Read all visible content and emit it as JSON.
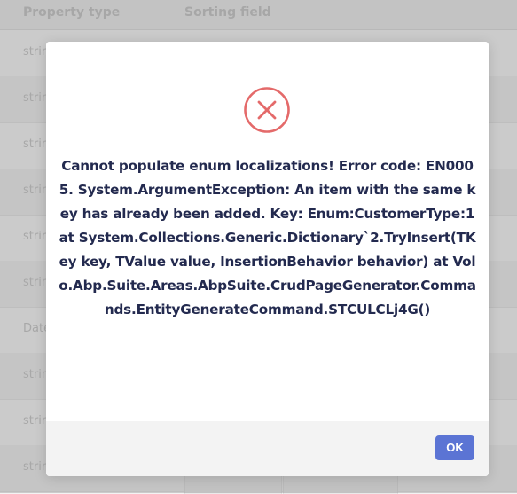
{
  "table": {
    "headers": [
      "Property type",
      "Sorting field"
    ],
    "rows": [
      "string",
      "string",
      "string",
      "string",
      "string",
      "string",
      "DateTime",
      "string",
      "string",
      "string"
    ]
  },
  "dialog": {
    "icon": "error-x-circle-icon",
    "message": "Cannot populate enum localizations! Error code: EN0005. System.ArgumentException: An item with the same key has already been added. Key: Enum:CustomerType:1 at System.Collections.Generic.Dictionary`2.TryInsert(TKey key, TValue value, InsertionBehavior behavior) at Volo.Abp.Suite.Areas.AbpSuite.CrudPageGenerator.Commands.EntityGenerateCommand.STCULCLj4G()",
    "ok_label": "OK"
  },
  "colors": {
    "accent": "#5b74d4",
    "error": "#e46a6a",
    "text": "#232a4f"
  }
}
